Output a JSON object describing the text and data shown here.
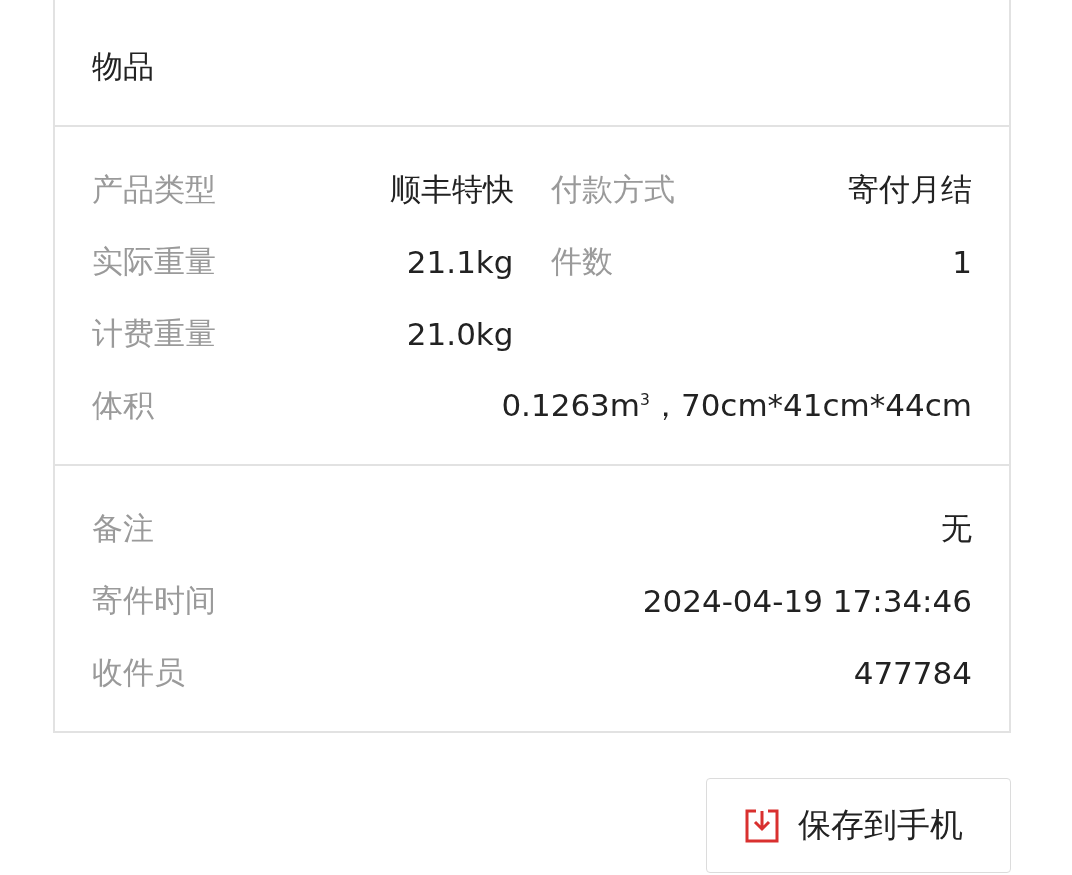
{
  "goods": {
    "value": "物品"
  },
  "details": [
    {
      "kind": "pair",
      "cells": [
        {
          "label": "产品类型",
          "value": "顺丰特快"
        },
        {
          "label": "付款方式",
          "value": "寄付月结"
        }
      ]
    },
    {
      "kind": "pair",
      "cells": [
        {
          "label": "实际重量",
          "value": "21.1kg"
        },
        {
          "label": "件数",
          "value": "1"
        }
      ]
    },
    {
      "kind": "pair",
      "cells": [
        {
          "label": "计费重量",
          "value": "21.0kg"
        }
      ]
    },
    {
      "kind": "wide",
      "cells": [
        {
          "label": "体积",
          "value": "0.1263m$^{3}$，70cm*41cm*44cm"
        }
      ]
    }
  ],
  "extra": [
    {
      "label": "备注",
      "value": "无"
    },
    {
      "label": "寄件时间",
      "value": "2024-04-19 17:34:46"
    },
    {
      "label": "收件员",
      "value": "477784"
    }
  ],
  "save_button": {
    "label": "保存到手机"
  }
}
